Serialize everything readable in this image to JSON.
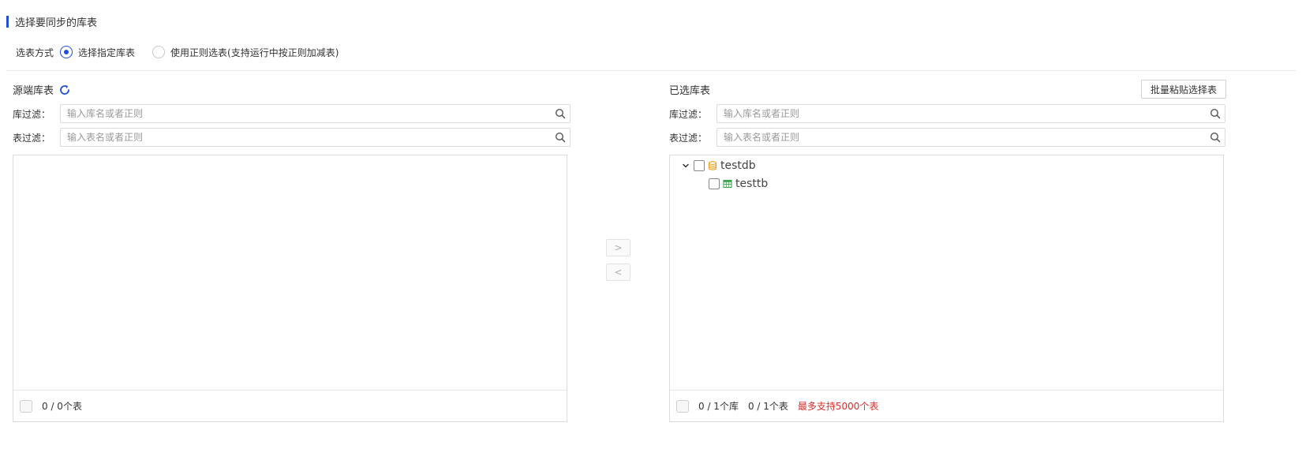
{
  "section": {
    "title": "选择要同步的库表"
  },
  "mode": {
    "label": "选表方式",
    "options": [
      {
        "label": "选择指定库表",
        "checked": true
      },
      {
        "label": "使用正则选表(支持运行中按正则加减表)",
        "checked": false
      }
    ]
  },
  "source": {
    "title": "源端库表",
    "db_filter": {
      "label": "库过滤：",
      "placeholder": "输入库名或者正则"
    },
    "table_filter": {
      "label": "表过滤：",
      "placeholder": "输入表名或者正则"
    },
    "footer": {
      "count": "0 / 0个表"
    }
  },
  "transfer": {
    "right": ">",
    "left": "<"
  },
  "selected": {
    "title": "已选库表",
    "batch_button": "批量粘贴选择表",
    "db_filter": {
      "label": "库过滤：",
      "placeholder": "输入库名或者正则"
    },
    "table_filter": {
      "label": "表过滤：",
      "placeholder": "输入表名或者正则"
    },
    "tree": [
      {
        "name": "testdb",
        "type": "database",
        "children": [
          {
            "name": "testtb",
            "type": "table"
          }
        ]
      }
    ],
    "footer": {
      "db_count": "0 / 1个库",
      "table_count": "0 / 1个表",
      "limit_warning": "最多支持5000个表"
    }
  },
  "colors": {
    "accent": "#1f4fd8",
    "warning": "#d9302c",
    "db_icon": "#f0a020",
    "table_icon": "#3aa64a"
  }
}
